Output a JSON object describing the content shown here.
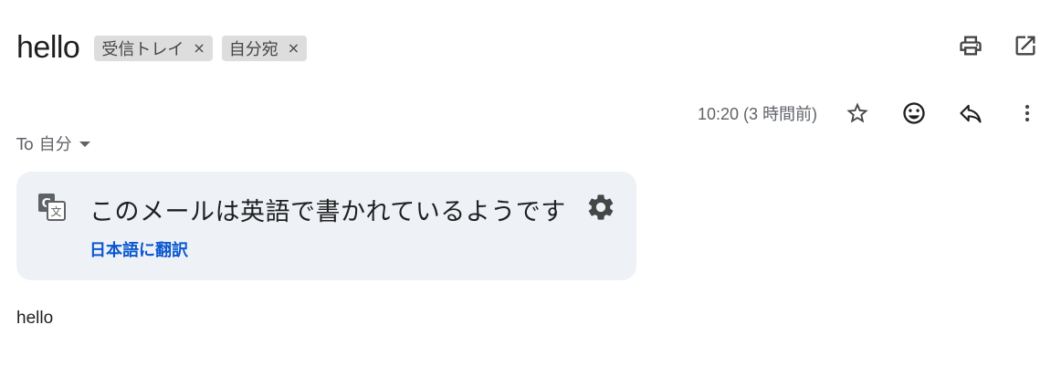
{
  "subject": "hello",
  "labels": [
    {
      "text": "受信トレイ",
      "close": "×"
    },
    {
      "text": "自分宛",
      "close": "×"
    }
  ],
  "timestamp": "10:20 (3 時間前)",
  "recipient": "To 自分",
  "translate_banner": {
    "message": "このメールは英語で書かれているようです",
    "link": "日本語に翻訳"
  },
  "body": "hello",
  "icons": {
    "print": "printer-icon",
    "open_new": "open-in-new-window-icon",
    "star": "star-icon",
    "emoji": "emoji-reaction-icon",
    "reply": "reply-icon",
    "more": "more-vert-icon",
    "translate": "translate-icon",
    "settings": "gear-icon"
  },
  "colors": {
    "link": "#0b57d0",
    "banner_bg": "#eef2f7",
    "label_bg": "#dddddd"
  }
}
